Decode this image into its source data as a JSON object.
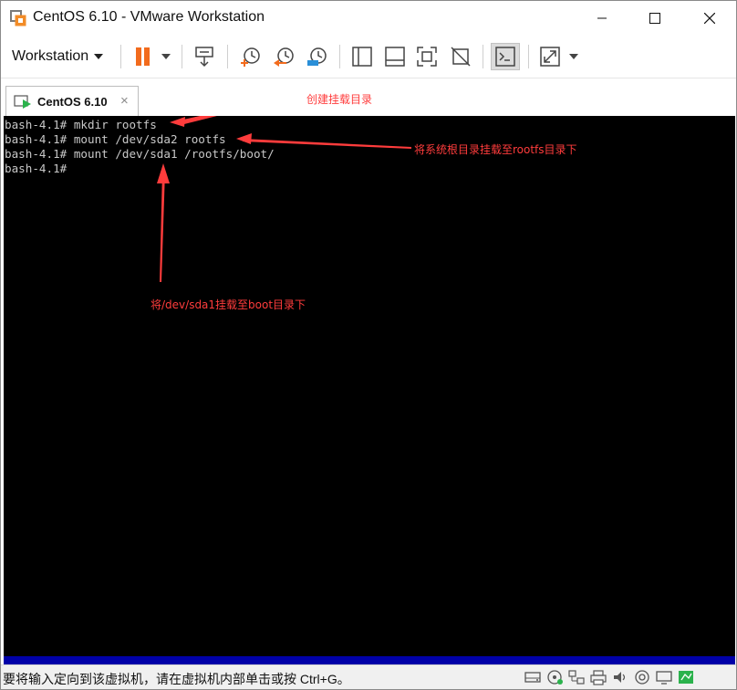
{
  "window": {
    "title": "CentOS 6.10 - VMware Workstation"
  },
  "toolbar": {
    "menu_label": "Workstation",
    "icons": [
      "pause-icon",
      "send-ctrl-alt-del-icon",
      "snapshot-icon",
      "revert-snapshot-icon",
      "snapshot-manager-icon",
      "show-library-icon",
      "thumbnail-bar-icon",
      "fullscreen-icon",
      "unity-icon",
      "console-view-icon",
      "stretch-icon"
    ]
  },
  "tab": {
    "label": "CentOS 6.10",
    "close_glyph": "×"
  },
  "terminal": {
    "lines": [
      "bash-4.1# mkdir rootfs",
      "bash-4.1# mount /dev/sda2 rootfs",
      "bash-4.1# mount /dev/sda1 /rootfs/boot/",
      "bash-4.1#"
    ]
  },
  "annotations": [
    {
      "text": "创建挂载目录"
    },
    {
      "text": "将系统根目录挂载至rootfs目录下"
    },
    {
      "text": "将/dev/sda1挂载至boot目录下"
    }
  ],
  "statusbar": {
    "message": "要将输入定向到该虚拟机，请在虚拟机内部单击或按 Ctrl+G。"
  },
  "colors": {
    "terminal_bg": "#000000",
    "terminal_fg": "#c8c8c8",
    "annotation": "#ff3c3c",
    "pause_orange": "#f26b1d",
    "vm_bottom_bar": "#0000a8"
  }
}
